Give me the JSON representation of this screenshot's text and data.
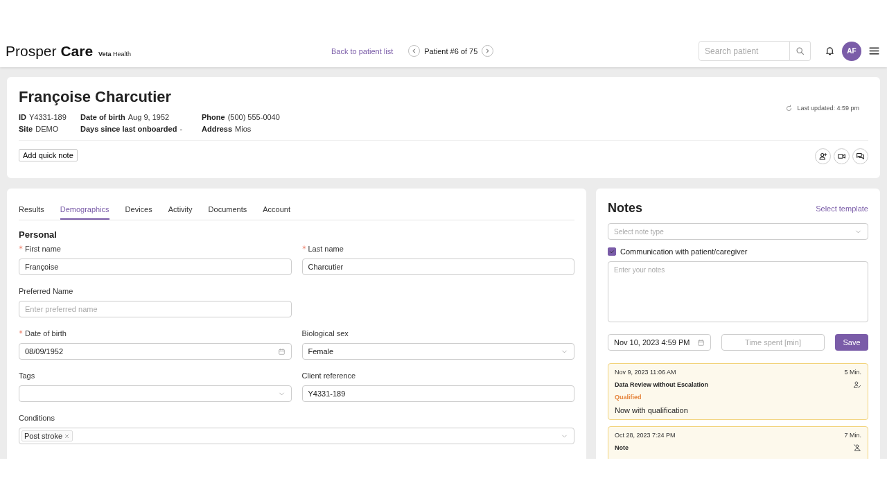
{
  "header": {
    "logo": "Prosper **Care**",
    "sublogo": "**Veta** Health",
    "back_link": "Back to patient list",
    "pager": "Patient #6 of 75",
    "search": {
      "placeholder": "Search patient"
    },
    "avatar": "AF"
  },
  "patient": {
    "name": "Françoise Charcutier",
    "last_updated": "Last updated: 4:59 pm",
    "info": [
      {
        "label": "ID",
        "value": "Y4331-189"
      },
      {
        "label": "Date of birth",
        "value": "Aug 9, 1952"
      },
      {
        "label": "Phone",
        "value": "(500) 555-0040"
      },
      {
        "label": "Site",
        "value": "DEMO"
      },
      {
        "label": "Days since last onboarded",
        "value": "-"
      },
      {
        "label": "Address",
        "value": "Mios"
      }
    ],
    "quick_note": "Add quick note"
  },
  "tabs": [
    {
      "label": "Results",
      "selected": false
    },
    {
      "label": "Demographics",
      "selected": true
    },
    {
      "label": "Devices",
      "selected": false
    },
    {
      "label": "Activity",
      "selected": false
    },
    {
      "label": "Documents",
      "selected": false
    },
    {
      "label": "Account",
      "selected": false
    }
  ],
  "section": "Personal",
  "field_rows": [
    [
      {
        "label": "First name",
        "required": true,
        "kind": "text",
        "value": "Françoise"
      },
      {
        "label": "Last name",
        "required": true,
        "kind": "text",
        "value": "Charcutier"
      }
    ],
    [
      {
        "label": "Preferred Name",
        "required": false,
        "kind": "text",
        "placeholder": "Enter preferred name"
      }
    ],
    [
      {
        "label": "Date of birth",
        "required": true,
        "kind": "date",
        "value": "08/09/1952"
      },
      {
        "label": "Biological sex",
        "required": false,
        "kind": "select",
        "value": "Female"
      }
    ],
    [
      {
        "label": "Tags",
        "required": false,
        "kind": "select"
      },
      {
        "label": "Client reference",
        "required": false,
        "kind": "text",
        "value": "Y4331-189"
      }
    ],
    [
      {
        "label": "Conditions",
        "required": false,
        "kind": "tags",
        "tags": [
          "Post stroke"
        ]
      }
    ]
  ],
  "notes": {
    "title": "Notes",
    "template_link": "Select template",
    "note_type": {
      "placeholder": "Select note type"
    },
    "communication": {
      "label": "Communication with patient/caregiver",
      "checked": true
    },
    "text": {
      "placeholder": "Enter your notes"
    },
    "date": "Nov 10, 2023 4:59 PM",
    "time_spent": {
      "placeholder": "Time spent [min]"
    },
    "save": "Save",
    "entries": [
      {
        "date": "Nov 9, 2023 11:06 AM",
        "minutes": "5 Min.",
        "title": "Data Review without Escalation",
        "status": "Qualified",
        "text": "Now with qualification",
        "qualified": true
      },
      {
        "date": "Oct 28, 2023 7:24 PM",
        "minutes": "7 Min.",
        "title": "Note",
        "qualified": false
      }
    ]
  }
}
